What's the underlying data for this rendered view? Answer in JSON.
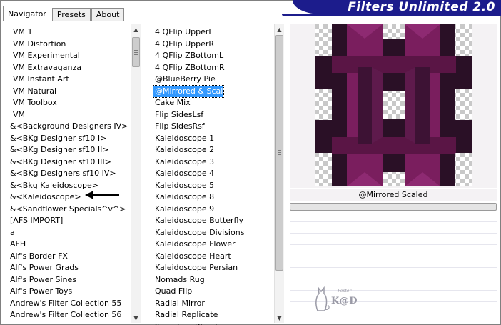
{
  "tabs": [
    {
      "label": "Navigator",
      "active": true
    },
    {
      "label": "Presets",
      "active": false
    },
    {
      "label": "About",
      "active": false
    }
  ],
  "app_title": "Filters Unlimited 2.0",
  "categories": [
    "VM 1",
    "VM Distortion",
    "VM Experimental",
    "VM Extravaganza",
    "VM Instant Art",
    "VM Natural",
    "VM Toolbox",
    "VM",
    "&<Background Designers IV>",
    "&<BKg Designer sf10 I>",
    "&<BKg Designer sf10 II>",
    "&<BKg Designer sf10 III>",
    "&<BKg Designers sf10 IV>",
    "&<Bkg Kaleidoscope>",
    "&<Kaleidoscope>",
    "&<Sandflower Specials^v^>",
    "[AFS IMPORT]",
    "a",
    "AFH",
    "Alf's Border FX",
    "Alf's Power Grads",
    "Alf's Power Sines",
    "Alf's Power Toys",
    "Andrew's Filter Collection 55",
    "Andrew's Filter Collection 56"
  ],
  "filters": [
    "4 QFlip UpperL",
    "4 QFlip UpperR",
    "4 QFlip ZBottomL",
    "4 QFlip ZBottomR",
    "@BlueBerry Pie",
    "@Mirrored & Scaled",
    "Cake Mix",
    "Flip SidesLsf",
    "Flip SidesRsf",
    "Kaleidoscope 1",
    "Kaleidoscope 2",
    "Kaleidoscope 3",
    "Kaleidoscope 4",
    "Kaleidoscope 5",
    "Kaleidoscope 8",
    "Kaleidoscope 9",
    "Kaleidoscope Butterfly",
    "Kaleidoscope Divisions",
    "Kaleidoscope Flower",
    "Kaleidoscope Heart",
    "Kaleidoscope Persian",
    "Nomads Rug",
    "Quad Flip",
    "Radial Mirror",
    "Radial Replicate",
    "Seamless Blend"
  ],
  "selected_filter_index": 5,
  "preview_caption": "@Mirrored  Scaled",
  "progress": 1.0,
  "watermark": {
    "small": "Poster",
    "text": "K@D"
  },
  "colors": {
    "title_bar": "#1c1c8c",
    "selection": "#3399ff",
    "preview_purple": "#7a1e5e",
    "preview_dark": "#2a1026"
  },
  "icons": [
    "scroll-up-arrow",
    "scroll-down-arrow",
    "pointer-arrow",
    "cat-watermark"
  ]
}
